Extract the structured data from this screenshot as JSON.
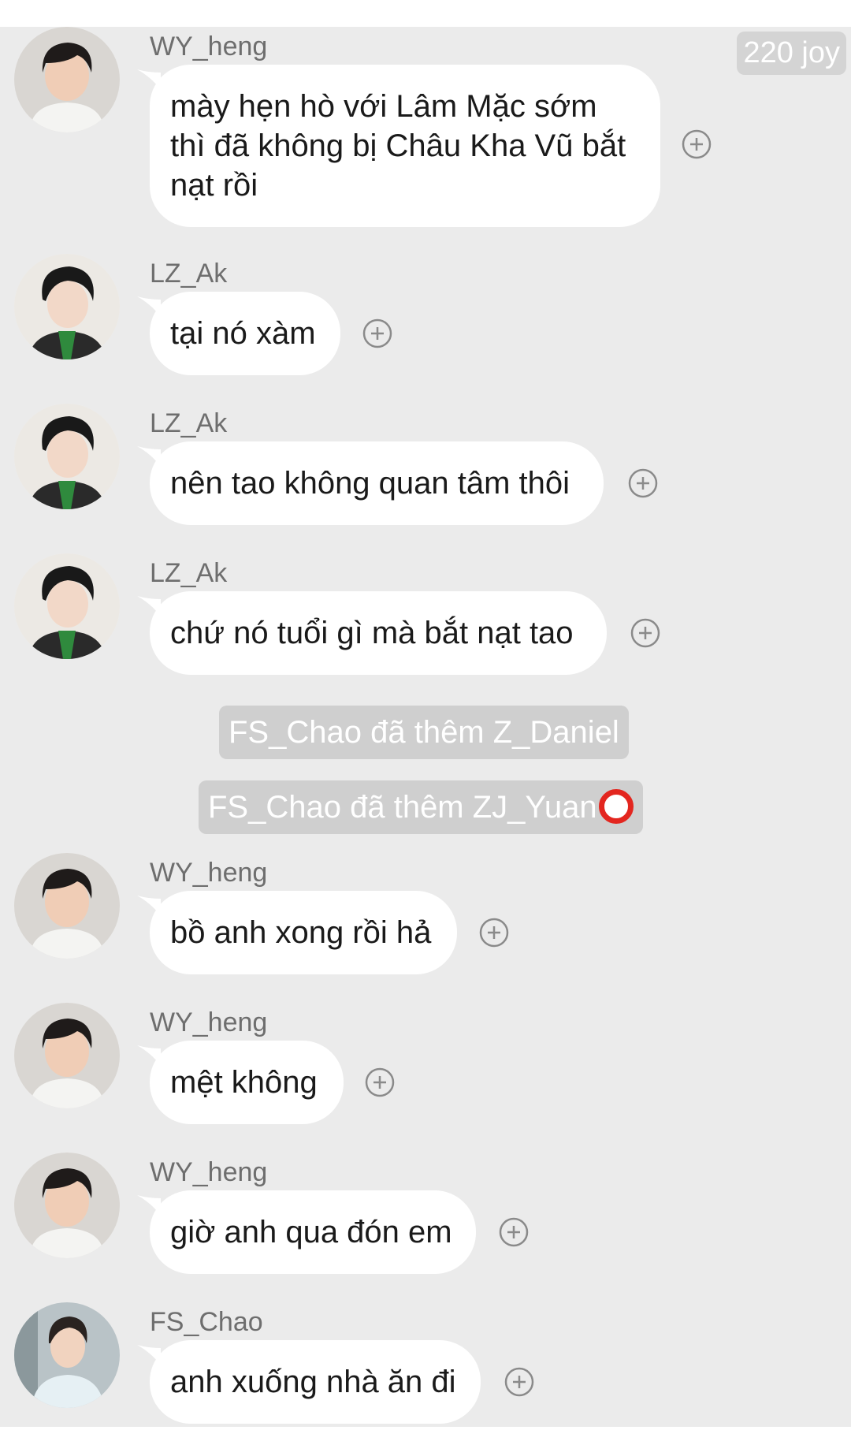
{
  "badge": {
    "text": "220 joy"
  },
  "messages": [
    {
      "sender": "WY_heng",
      "text": "mày hẹn hò với Lâm Mặc sớm thì đã không bị Châu Kha Vũ bắt nạt rồi"
    },
    {
      "sender": "LZ_Ak",
      "text": "tại nó xàm"
    },
    {
      "sender": "LZ_Ak",
      "text": "nên tao không quan tâm thôi"
    },
    {
      "sender": "LZ_Ak",
      "text": "chứ nó tuổi gì mà bắt nạt tao"
    },
    {
      "sender": "WY_heng",
      "text": "bồ anh xong rồi hả"
    },
    {
      "sender": "WY_heng",
      "text": "mệt không"
    },
    {
      "sender": "WY_heng",
      "text": "giờ anh qua đón em"
    },
    {
      "sender": "FS_Chao",
      "text": "anh xuống nhà ăn đi"
    }
  ],
  "system": [
    {
      "text": "FS_Chao đã thêm Z_Daniel"
    },
    {
      "text": "FS_Chao đã thêm ZJ_Yuan"
    }
  ],
  "colors": {
    "chat_bg": "#ebebeb",
    "bubble": "#ffffff",
    "system_pill": "#cfcfcf",
    "ring": "#e3261f"
  }
}
